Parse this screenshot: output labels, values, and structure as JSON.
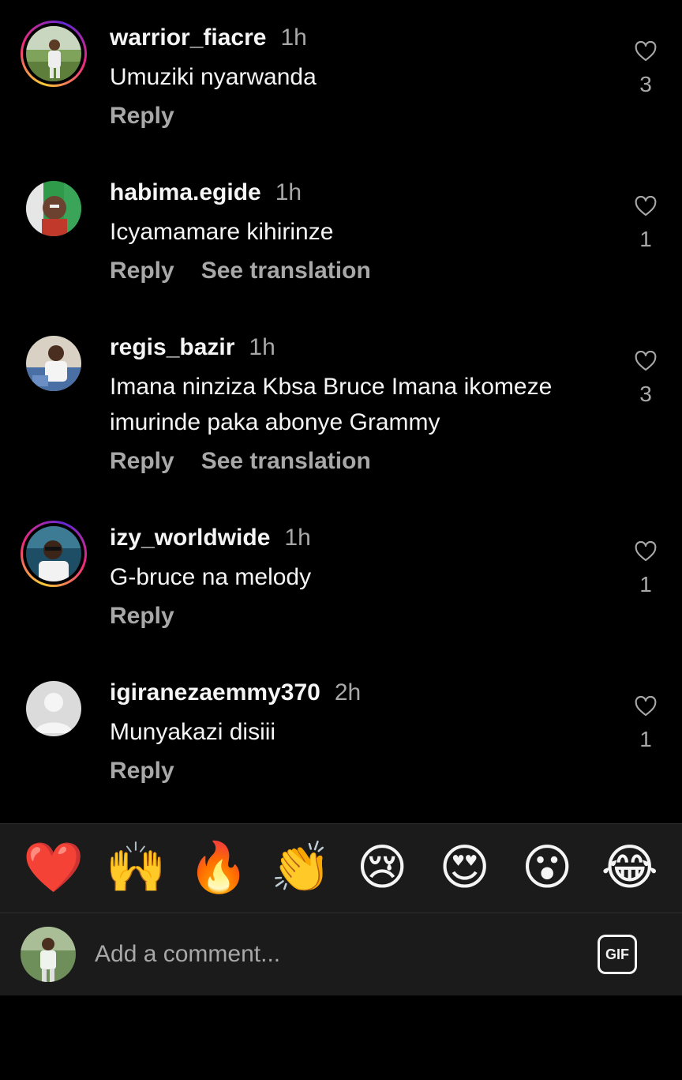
{
  "comments": [
    {
      "username": "warrior_fiacre",
      "time": "1h",
      "text": "Umuziki nyarwanda",
      "reply_label": "Reply",
      "translate_label": "",
      "likes": "3",
      "story_ring": true
    },
    {
      "username": "habima.egide",
      "time": "1h",
      "text": "Icyamamare kihirinze",
      "reply_label": "Reply",
      "translate_label": "See translation",
      "likes": "1",
      "story_ring": false
    },
    {
      "username": "regis_bazir",
      "time": "1h",
      "text": "Imana ninziza Kbsa Bruce Imana ikomeze imurinde paka abonye Grammy",
      "reply_label": "Reply",
      "translate_label": "See translation",
      "likes": "3",
      "story_ring": false
    },
    {
      "username": "izy_worldwide",
      "time": "1h",
      "text": "G-bruce na melody",
      "reply_label": "Reply",
      "translate_label": "",
      "likes": "1",
      "story_ring": true
    },
    {
      "username": "igiranezaemmy370",
      "time": "2h",
      "text": "Munyakazi disiii",
      "reply_label": "Reply",
      "translate_label": "",
      "likes": "1",
      "story_ring": false
    }
  ],
  "emoji_bar": [
    "❤️",
    "🙌",
    "🔥",
    "👏",
    "😢",
    "😍",
    "😮",
    "😂"
  ],
  "composer": {
    "placeholder": "Add a comment...",
    "gif_label": "GIF"
  },
  "colors": {
    "background": "#000000",
    "panel": "#1b1b1b",
    "primary_text": "#f5f5f5",
    "secondary_text": "#a8a8a8",
    "ring_gradient": [
      "#f9ce34",
      "#ee2a7b",
      "#6228d7"
    ]
  },
  "icons": {
    "like": "heart-outline-icon",
    "default_avatar": "default-avatar-icon"
  }
}
